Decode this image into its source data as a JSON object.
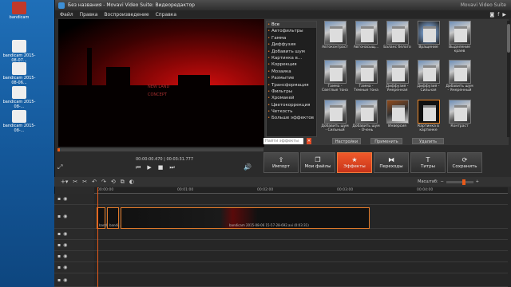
{
  "desktop": {
    "icons": [
      {
        "label": "bandicam 2015-08-07..."
      },
      {
        "label": "bandicam 2015-08-06..."
      },
      {
        "label": "bandicam 2015-08-..."
      },
      {
        "label": "bandicam 2015-08-..."
      }
    ],
    "top_labels": [
      "bandicam",
      "bk"
    ]
  },
  "window": {
    "title": "Без названия - Movavi Video Suite: Видеоредактор",
    "brand": "Movavi Video Suite"
  },
  "menu": {
    "items": [
      "Файл",
      "Правка",
      "Воспроизведение",
      "Справка"
    ]
  },
  "preview": {
    "overlay_line1": "NEW LAND",
    "overlay_line2": "CONCEPT"
  },
  "effects": {
    "categories": [
      "Все",
      "Автофильтры",
      "Гамма",
      "Диффузия",
      "Добавить шум",
      "Картинка в...",
      "Коррекция",
      "Мозаика",
      "Размытие",
      "Трансформация",
      "Фильтры",
      "Хромакей",
      "Цветокоррекция",
      "Четкость",
      "Больше эффектов"
    ],
    "thumbnails": [
      "Автоконтраст",
      "Автонасыщ...",
      "Баланс белого",
      "Вращение",
      "Выделение краев",
      "",
      "Гамма - Светлые тона",
      "Гамма - Темные тона",
      "Диффузия - Умеренная",
      "Диффузия - Сильная",
      "Добавить шум - Умеренный",
      "",
      "Добавить шум - Сильный",
      "Добавить шум - Очень",
      "Инверсия",
      "Картинка в картинке",
      "Контраст",
      ""
    ],
    "search_placeholder": "Найти эффекты",
    "settings_label": "Настройки",
    "apply_label": "Применить",
    "delete_label": "Удалить"
  },
  "player": {
    "time": "00:00:00.470 | 00:03:31.777"
  },
  "toolbar": {
    "import_label": "Импорт",
    "files_label": "Мои файлы",
    "effects_label": "Эффекты",
    "transitions_label": "Переходы",
    "titles_label": "Титры",
    "save_label": "Сохранить"
  },
  "timeline": {
    "zoom_label": "Масштаб:",
    "ruler": [
      "00:00:00",
      "00:01:00",
      "00:02:00",
      "00:03:00",
      "00:04:00"
    ],
    "clip_label": "bandicam 2015-08-06 15-57-28-692.avi (0:03:31)",
    "small_clip_1": "bandi..",
    "small_clip_2": "bandi.."
  },
  "colors": {
    "accent": "#e85a1a",
    "panel": "#2b2b2b",
    "desktop": "#1a5a9e"
  }
}
